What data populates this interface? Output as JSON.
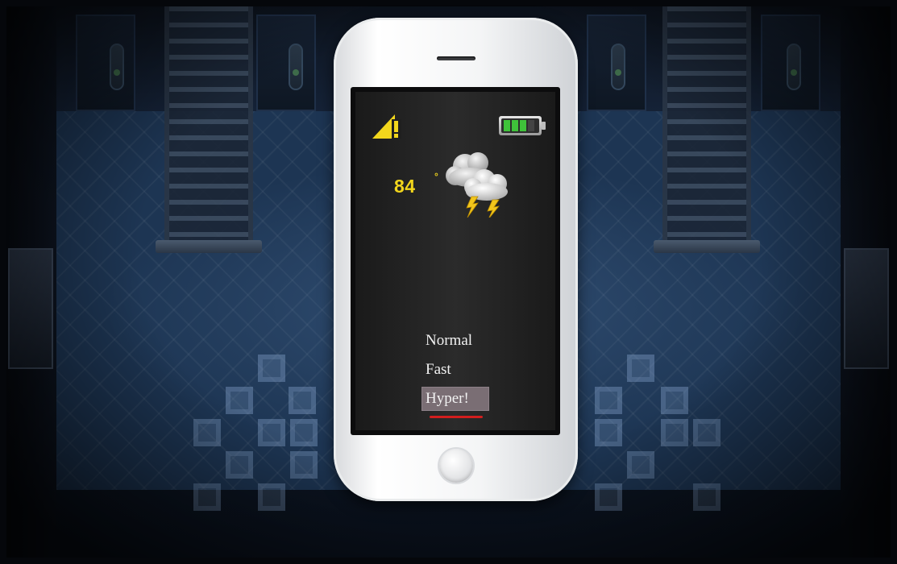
{
  "phone": {
    "status_bar": {
      "signal_icon": "signal-warning-icon",
      "battery_icon": "battery-icon",
      "battery_level": 0.75,
      "accent_color": "#f2d61c",
      "battery_color": "#3fc23a"
    },
    "weather": {
      "temperature": "84",
      "degree_symbol": "°",
      "condition_icon": "thunderstorm-cloud-icon"
    },
    "speed_menu": {
      "items": [
        {
          "label": "Normal",
          "selected": false
        },
        {
          "label": "Fast",
          "selected": false
        },
        {
          "label": "Hyper!",
          "selected": true
        }
      ],
      "selection_color": "#7a6e74",
      "underline_color": "#d21e1e"
    }
  }
}
